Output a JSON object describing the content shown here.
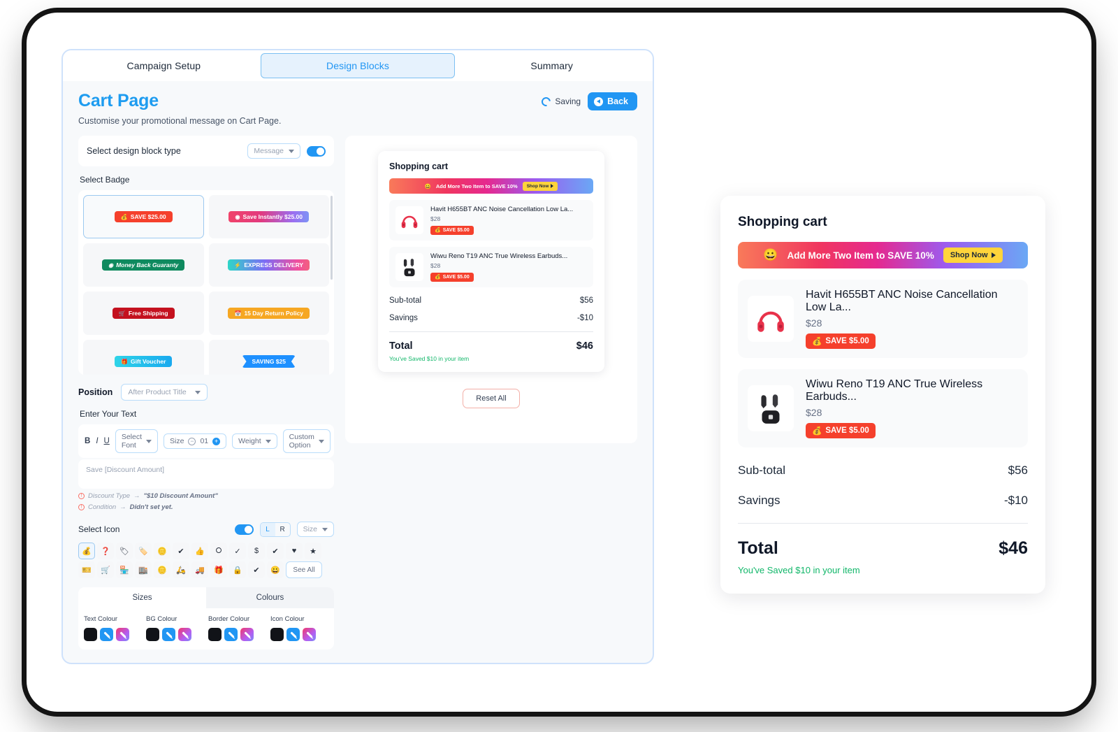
{
  "tabs": [
    {
      "label": "Campaign Setup",
      "active": false
    },
    {
      "label": "Design Blocks",
      "active": true
    },
    {
      "label": "Summary",
      "active": false
    }
  ],
  "header": {
    "title": "Cart Page",
    "subtitle": "Customise your promotional message on Cart Page.",
    "saving_label": "Saving",
    "back_label": "Back"
  },
  "design_block_row": {
    "label": "Select design block type",
    "select_value": "Message",
    "toggle_on": true
  },
  "badges": {
    "section_label": "Select Badge",
    "items": [
      {
        "text": "SAVE $25.00",
        "icon": "💰",
        "style": "solid-red",
        "selected": true
      },
      {
        "text": "Save Instantly $25.00",
        "icon": "◉",
        "style": "grad-pink-blue",
        "selected": false
      },
      {
        "text": "Money Back Guaranty",
        "icon": "◉",
        "style": "solid-green",
        "selected": false
      },
      {
        "text": "EXPRESS DELIVERY",
        "icon": "⚡",
        "style": "grad-teal-pink",
        "selected": false
      },
      {
        "text": "Free Shipping",
        "icon": "🛒",
        "style": "solid-darkred",
        "selected": false
      },
      {
        "text": "15 Day Return Policy",
        "icon": "📅",
        "style": "solid-orange",
        "selected": false
      },
      {
        "text": "Gift Voucher",
        "icon": "🎁",
        "style": "grad-cyan",
        "selected": false
      },
      {
        "text": "SAVING $25",
        "icon": "",
        "style": "ribbon-blue",
        "selected": false
      }
    ]
  },
  "position": {
    "label": "Position",
    "value": "After Product Title"
  },
  "text_editor": {
    "label": "Enter Your Text",
    "bold": "B",
    "italic": "I",
    "underline": "U",
    "font_select": "Select Font",
    "size_label": "Size",
    "size_value": "01",
    "weight_select": "Weight",
    "custom_option": "Custom Option",
    "placeholder": "Save [Discount Amount]",
    "hint_discount_prefix": "Discount Type",
    "hint_discount_value": "\"$10 Discount Amount\"",
    "hint_condition_prefix": "Condition",
    "hint_condition_value": "Didn't set yet.",
    "arrow": "→"
  },
  "icons": {
    "label": "Select Icon",
    "toggle_on": true,
    "align_left": "L",
    "align_right": "R",
    "size_select": "Size",
    "see_all": "See All",
    "row1": [
      {
        "name": "money-bag-icon",
        "glyph": "💰",
        "selected": true
      },
      {
        "name": "question-circle-icon",
        "glyph": "❓",
        "selected": false
      },
      {
        "name": "badge-shield-icon",
        "glyph": "🏷",
        "selected": false
      },
      {
        "name": "tag-icon",
        "glyph": "🏷️",
        "selected": false
      },
      {
        "name": "coin-icon",
        "glyph": "🪙",
        "selected": false
      },
      {
        "name": "check-badge-icon",
        "glyph": "✔",
        "selected": false
      },
      {
        "name": "thumbs-up-icon",
        "glyph": "👍",
        "selected": false
      },
      {
        "name": "ring-icon",
        "glyph": "⭘",
        "selected": false
      },
      {
        "name": "check-icon",
        "glyph": "✓",
        "selected": false
      },
      {
        "name": "dollar-icon",
        "glyph": "$",
        "selected": false
      },
      {
        "name": "verified-icon",
        "glyph": "✔",
        "selected": false
      },
      {
        "name": "heart-icon",
        "glyph": "♥",
        "selected": false
      },
      {
        "name": "star-icon",
        "glyph": "★",
        "selected": false
      }
    ],
    "row2": [
      {
        "name": "buy-tag-icon",
        "glyph": "🎫",
        "selected": false
      },
      {
        "name": "cart-arrow-icon",
        "glyph": "🛒",
        "selected": false
      },
      {
        "name": "shop-icon",
        "glyph": "🏪",
        "selected": false
      },
      {
        "name": "store-icon",
        "glyph": "🏬",
        "selected": false
      },
      {
        "name": "coin-hand-icon",
        "glyph": "🪙",
        "selected": false
      },
      {
        "name": "delivery-person-icon",
        "glyph": "🛵",
        "selected": false
      },
      {
        "name": "truck-icon",
        "glyph": "🚚",
        "selected": false
      },
      {
        "name": "gift-icon",
        "glyph": "🎁",
        "selected": false
      },
      {
        "name": "lock-icon",
        "glyph": "🔒",
        "selected": false
      },
      {
        "name": "shield-check-icon",
        "glyph": "✔",
        "selected": false
      },
      {
        "name": "smiley-icon",
        "glyph": "😀",
        "selected": false
      }
    ]
  },
  "sizes_colours": {
    "tab_sizes": "Sizes",
    "tab_colours": "Colours",
    "columns": [
      {
        "name": "Text Colour",
        "swatches": [
          "black",
          "blue",
          "grad"
        ]
      },
      {
        "name": "BG Colour",
        "swatches": [
          "black",
          "blue",
          "grad"
        ]
      },
      {
        "name": "Border Colour",
        "swatches": [
          "black",
          "blue",
          "grad"
        ]
      },
      {
        "name": "Icon Colour",
        "swatches": [
          "black",
          "blue",
          "grad"
        ]
      }
    ]
  },
  "cart_preview": {
    "title": "Shopping cart",
    "promo": {
      "emoji": "😀",
      "text": "Add More Two Item to SAVE 10%",
      "cta": "Shop Now"
    },
    "items": [
      {
        "title": "Havit H655BT ANC Noise Cancellation Low La...",
        "price": "$28",
        "badge": "SAVE $5.00",
        "badge_icon": "💰",
        "thumb": "headphones-red"
      },
      {
        "title": "Wiwu Reno T19 ANC True Wireless Earbuds...",
        "price": "$28",
        "badge": "SAVE $5.00",
        "badge_icon": "💰",
        "thumb": "earbuds-black"
      }
    ],
    "subtotal_label": "Sub-total",
    "subtotal_value": "$56",
    "savings_label": "Savings",
    "savings_value": "-$10",
    "total_label": "Total",
    "total_value": "$46",
    "saved_note": "You've Saved $10 in your item",
    "reset_label": "Reset All"
  },
  "colors": {
    "accent": "#2196f3",
    "badge_red": "#f5402c",
    "green": "#12b76a",
    "yellow": "#ffd43b"
  }
}
